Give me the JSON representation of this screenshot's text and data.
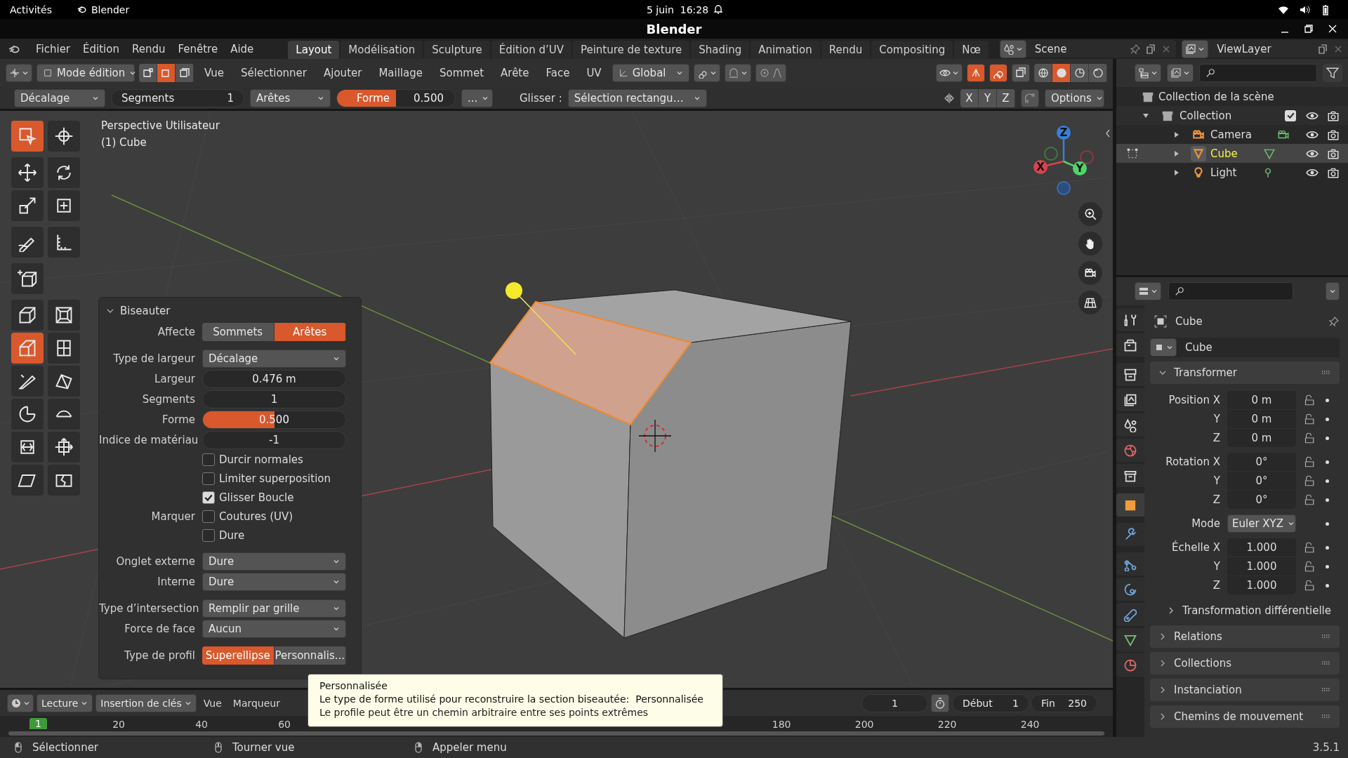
{
  "system_bar": {
    "activities": "Activités",
    "app": "Blender",
    "date": "5 juin",
    "time": "16:28"
  },
  "window": {
    "title": "Blender"
  },
  "menu": [
    "Fichier",
    "Édition",
    "Rendu",
    "Fenêtre",
    "Aide"
  ],
  "workspaces": [
    {
      "label": "Layout",
      "selected": true
    },
    {
      "label": "Modélisation",
      "selected": false
    },
    {
      "label": "Sculpture",
      "selected": false
    },
    {
      "label": "Édition d’UV",
      "selected": false
    },
    {
      "label": "Peinture de texture",
      "selected": false
    },
    {
      "label": "Shading",
      "selected": false
    },
    {
      "label": "Animation",
      "selected": false
    },
    {
      "label": "Rendu",
      "selected": false
    },
    {
      "label": "Compositing",
      "selected": false
    },
    {
      "label": "Nœ",
      "selected": false
    }
  ],
  "scene": {
    "name": "Scene"
  },
  "view_layer": {
    "name": "ViewLayer"
  },
  "viewport_header": {
    "mode": "Mode édition",
    "select_modes": [
      {
        "kind": "vertex",
        "selected": false
      },
      {
        "kind": "edge",
        "selected": true
      },
      {
        "kind": "face",
        "selected": false
      }
    ],
    "menus": [
      "Vue",
      "Sélectionner",
      "Ajouter",
      "Maillage",
      "Sommet",
      "Arête",
      "Face",
      "UV"
    ],
    "orientation": "Global",
    "toggles": [
      {
        "kind": "gizmo",
        "on": true
      },
      {
        "kind": "overlay",
        "on": true
      },
      {
        "kind": "xray",
        "on": false
      }
    ],
    "shading": [
      {
        "kind": "wireframe",
        "selected": false
      },
      {
        "kind": "solid",
        "selected": true
      },
      {
        "kind": "material",
        "selected": false
      },
      {
        "kind": "rendered",
        "selected": false
      }
    ]
  },
  "tool_settings": {
    "width_type": "Décalage",
    "segments": {
      "label": "Segments",
      "value": "1"
    },
    "affect": "Arêtes",
    "shape": {
      "label": "Forme",
      "value": "0.500",
      "level": 0.5
    },
    "more": "...",
    "slide_label": "Glisser :",
    "select_mode": "Sélection rectangu…",
    "axes": [
      "X",
      "Y",
      "Z"
    ],
    "options": "Options"
  },
  "viewport": {
    "info": [
      "Perspective Utilisateur",
      "(1) Cube"
    ],
    "axes": [
      "X",
      "Y",
      "Z"
    ]
  },
  "tools": [
    {
      "items": [
        {
          "kind": "select-box",
          "selected": true
        },
        {
          "kind": "cursor",
          "selected": false
        }
      ]
    },
    {
      "items": [
        {
          "kind": "move",
          "selected": false
        },
        {
          "kind": "rotate",
          "selected": false
        },
        {
          "kind": "scale",
          "selected": false
        },
        {
          "kind": "transform",
          "selected": false
        }
      ]
    },
    {
      "items": [
        {
          "kind": "annotate",
          "selected": false
        },
        {
          "kind": "measure",
          "selected": false
        }
      ]
    },
    {
      "items": [
        {
          "kind": "add-cube",
          "selected": false
        }
      ]
    },
    {
      "items": [
        {
          "kind": "extrude",
          "selected": false
        },
        {
          "kind": "inset",
          "selected": false
        },
        {
          "kind": "bevel",
          "selected": true
        },
        {
          "kind": "loop-cut",
          "selected": false
        },
        {
          "kind": "knife",
          "selected": false
        },
        {
          "kind": "poly-build",
          "selected": false
        },
        {
          "kind": "spin",
          "selected": false
        },
        {
          "kind": "smooth",
          "selected": false
        },
        {
          "kind": "edge-slide",
          "selected": false
        },
        {
          "kind": "shrink",
          "selected": false
        },
        {
          "kind": "shear",
          "selected": false
        },
        {
          "kind": "rip",
          "selected": false
        }
      ]
    }
  ],
  "bevel_panel": {
    "title": "Biseauter",
    "expanded": true,
    "sections": [
      {
        "rows": [
          {
            "kind": "toggle",
            "label": "Affecte",
            "options": [
              {
                "label": "Sommets",
                "selected": false
              },
              {
                "label": "Arêtes",
                "selected": true
              }
            ]
          }
        ]
      },
      {
        "rows": [
          {
            "kind": "dropdown",
            "label": "Type de largeur",
            "value": "Décalage"
          },
          {
            "kind": "number",
            "label": "Largeur",
            "value": "0.476 m"
          },
          {
            "kind": "number",
            "label": "Segments",
            "value": "1"
          },
          {
            "kind": "slider",
            "label": "Forme",
            "value": "0.500",
            "level": 0.5
          },
          {
            "kind": "number",
            "label": "Indice de matériau",
            "value": "-1"
          },
          {
            "kind": "checkbox",
            "text": "Durcir normales",
            "checked": false
          },
          {
            "kind": "checkbox",
            "text": "Limiter superposition",
            "checked": false
          },
          {
            "kind": "checkbox",
            "text": "Glisser Boucle",
            "checked": true
          },
          {
            "kind": "checkbox",
            "label": "Marquer",
            "text": "Coutures (UV)",
            "checked": false
          },
          {
            "kind": "checkbox",
            "text": "Dure",
            "checked": false
          }
        ]
      },
      {
        "rows": [
          {
            "kind": "dropdown",
            "label": "Onglet externe",
            "value": "Dure"
          },
          {
            "kind": "dropdown",
            "label": "Interne",
            "value": "Dure"
          }
        ]
      },
      {
        "rows": [
          {
            "kind": "dropdown",
            "label": "Type d’intersection",
            "value": "Remplir par grille"
          },
          {
            "kind": "dropdown",
            "label": "Force de face",
            "value": "Aucun"
          }
        ]
      },
      {
        "rows": [
          {
            "kind": "toggle",
            "label": "Type de profil",
            "options": [
              {
                "label": "Superellipse",
                "selected": true
              },
              {
                "label": "Personnalis...",
                "selected": false
              }
            ]
          }
        ]
      }
    ]
  },
  "outliner": {
    "tree": {
      "label": "Collection de la scène",
      "kind": "scene-collection",
      "selected": false,
      "children": [
        {
          "label": "Collection",
          "kind": "collection",
          "selected": false,
          "expanded": true,
          "checked": true,
          "children": [
            {
              "label": "Camera",
              "kind": "camera",
              "selected": false,
              "expanded": false
            },
            {
              "label": "Cube",
              "kind": "mesh",
              "selected": true,
              "expanded": false
            },
            {
              "label": "Light",
              "kind": "light",
              "selected": false,
              "expanded": false
            }
          ]
        }
      ]
    }
  },
  "properties": {
    "tabs": [
      {
        "kind": "tool",
        "selected": false
      },
      {
        "kind": "render",
        "selected": false
      },
      {
        "kind": "output",
        "selected": false
      },
      {
        "kind": "view-layer",
        "selected": false
      },
      {
        "kind": "scene",
        "selected": false
      },
      {
        "kind": "world",
        "selected": false
      },
      {
        "kind": "collection",
        "selected": false
      },
      {
        "kind": "object",
        "selected": true
      },
      {
        "kind": "modifier",
        "selected": false
      },
      {
        "kind": "particles",
        "selected": false
      },
      {
        "kind": "physics",
        "selected": false
      },
      {
        "kind": "constraint",
        "selected": false
      },
      {
        "kind": "data",
        "selected": false
      },
      {
        "kind": "material",
        "selected": false
      }
    ],
    "object": "Cube",
    "name_field": "Cube",
    "transform": {
      "title": "Transformer",
      "expanded": true,
      "groups": [
        {
          "kind": "fields",
          "rows": [
            {
              "label": "Position X",
              "value": "0 m"
            },
            {
              "label": "Y",
              "value": "0 m"
            },
            {
              "label": "Z",
              "value": "0 m"
            }
          ]
        },
        {
          "kind": "fields",
          "rows": [
            {
              "label": "Rotation X",
              "value": "0°"
            },
            {
              "label": "Y",
              "value": "0°"
            },
            {
              "label": "Z",
              "value": "0°"
            }
          ]
        },
        {
          "kind": "dropdown",
          "rows": [
            {
              "label": "Mode",
              "value": "Euler XYZ"
            }
          ]
        },
        {
          "kind": "fields",
          "rows": [
            {
              "label": "Échelle X",
              "value": "1.000"
            },
            {
              "label": "Y",
              "value": "1.000"
            },
            {
              "label": "Z",
              "value": "1.000"
            }
          ]
        }
      ],
      "subpanel": {
        "title": "Transformation différentielle",
        "expanded": false
      }
    },
    "panels": [
      {
        "title": "Relations",
        "expanded": false
      },
      {
        "title": "Collections",
        "expanded": false
      },
      {
        "title": "Instanciation",
        "expanded": false
      },
      {
        "title": "Chemins de mouvement",
        "expanded": false
      }
    ]
  },
  "timeline": {
    "menus": [
      {
        "kind": "dropdown",
        "label": "Lecture"
      },
      {
        "kind": "dropdown",
        "label": "Insertion de clés"
      },
      {
        "kind": "menu",
        "label": "Vue"
      },
      {
        "kind": "menu",
        "label": "Marqueur"
      }
    ],
    "current_frame": "1",
    "start": {
      "label": "Début",
      "value": "1"
    },
    "end": {
      "label": "Fin",
      "value": "250"
    },
    "playhead": "1",
    "ticks": [
      "20",
      "40",
      "60",
      "180",
      "200",
      "220",
      "240"
    ]
  },
  "status_bar": {
    "items": [
      "Sélectionner",
      "Tourner vue",
      "Appeler menu"
    ],
    "version": "3.5.1"
  },
  "tooltip": {
    "title": "Personnalisée",
    "text": "Le type de forme utilisé pour reconstruire la section biseautée:",
    "value": "Personnalisée",
    "description": "Le profile peut être un chemin arbitraire entre ses points extrêmes"
  }
}
